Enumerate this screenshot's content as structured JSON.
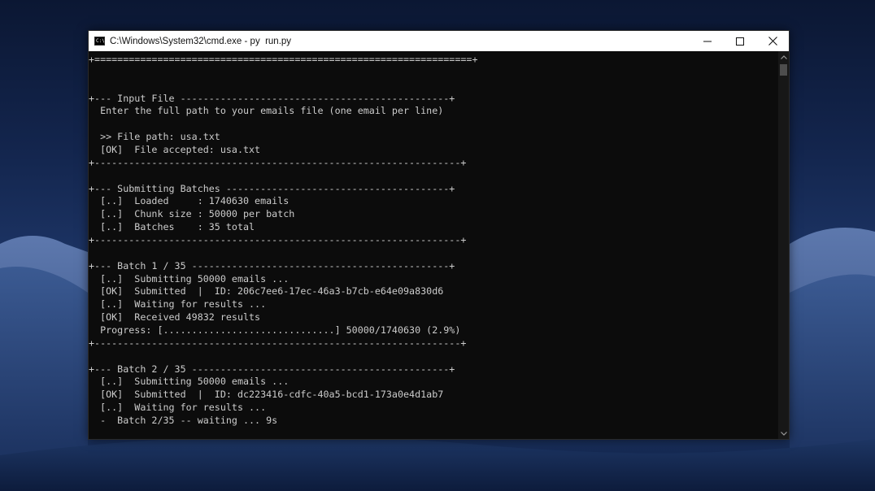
{
  "window": {
    "title": "C:\\Windows\\System32\\cmd.exe - py  run.py",
    "app_icon": "cmd-icon",
    "app_icon_text": "C:\\",
    "controls": [
      "minimize-icon",
      "maximize-icon",
      "close-icon"
    ]
  },
  "console": {
    "lines": [
      "+==================================================================+",
      "",
      "",
      "+--- Input File -----------------------------------------------+",
      "  Enter the full path to your emails file (one email per line)",
      "",
      "  >> File path: usa.txt",
      "  [OK]  File accepted: usa.txt",
      "+----------------------------------------------------------------+",
      "",
      "+--- Submitting Batches ---------------------------------------+",
      "  [..]  Loaded     : 1740630 emails",
      "  [..]  Chunk size : 50000 per batch",
      "  [..]  Batches    : 35 total",
      "+----------------------------------------------------------------+",
      "",
      "+--- Batch 1 / 35 ---------------------------------------------+",
      "  [..]  Submitting 50000 emails ...",
      "  [OK]  Submitted  |  ID: 206c7ee6-17ec-46a3-b7cb-e64e09a830d6",
      "  [..]  Waiting for results ...",
      "  [OK]  Received 49832 results",
      "  Progress: [..............................] 50000/1740630 (2.9%)",
      "+----------------------------------------------------------------+",
      "",
      "+--- Batch 2 / 35 ---------------------------------------------+",
      "  [..]  Submitting 50000 emails ...",
      "  [OK]  Submitted  |  ID: dc223416-cdfc-40a5-bcd1-173a0e4d1ab7",
      "  [..]  Waiting for results ...",
      "  -  Batch 2/35 -- waiting ... 9s"
    ]
  },
  "scrollbar": {
    "up_icon": "chevron-up-icon",
    "down_icon": "chevron-down-icon"
  },
  "colors": {
    "console_bg": "#0c0c0c",
    "console_text": "#cccccc",
    "titlebar_bg": "#ffffff"
  }
}
